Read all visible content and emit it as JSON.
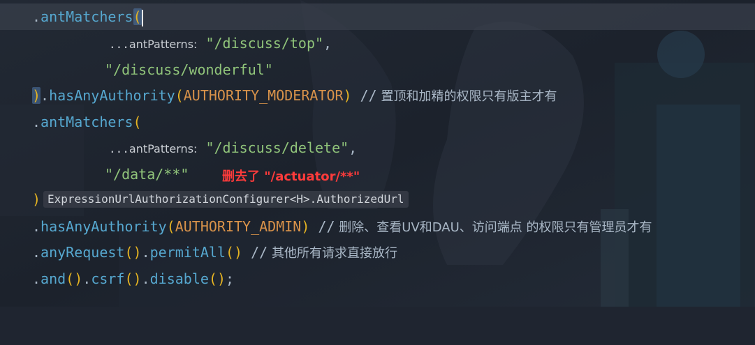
{
  "code": {
    "line1": {
      "dot": ".",
      "method": "antMatchers",
      "paren": "("
    },
    "line2": {
      "ellipsis": "...",
      "hint": "antPatterns:",
      "string": "\"/discuss/top\"",
      "comma": ","
    },
    "line3": {
      "string": "\"/discuss/wonderful\""
    },
    "line4": {
      "paren_close": ")",
      "dot": ".",
      "method": "hasAnyAuthority",
      "paren_open": "(",
      "constant": "AUTHORITY_MODERATOR",
      "paren_close2": ")",
      "comment_slashes": "//",
      "comment_text": "置顶和加精的权限只有版主才有"
    },
    "line5": {
      "dot": ".",
      "method": "antMatchers",
      "paren": "("
    },
    "line6": {
      "ellipsis": "...",
      "hint": "antPatterns:",
      "string": "\"/discuss/delete\"",
      "comma": ","
    },
    "line7": {
      "string": "\"/data/**\""
    },
    "line8": {
      "paren_close": ")",
      "type_hint": "ExpressionUrlAuthorizationConfigurer<H>.AuthorizedUrl"
    },
    "line9": {
      "dot": ".",
      "method": "hasAnyAuthority",
      "paren_open": "(",
      "constant": "AUTHORITY_ADMIN",
      "paren_close": ")",
      "comment_slashes": "//",
      "comment_text": "删除、查看UV和DAU、访问端点 的权限只有管理员才有"
    },
    "line10": {
      "dot": ".",
      "method": "anyRequest",
      "parens1": "()",
      "dot2": ".",
      "method2": "permitAll",
      "parens2": "()",
      "comment_slashes": "//",
      "comment_text": "其他所有请求直接放行"
    },
    "line11": {
      "dot": ".",
      "method": "and",
      "parens1": "()",
      "dot2": ".",
      "method2": "csrf",
      "parens2": "()",
      "dot3": ".",
      "method3": "disable",
      "parens3": "()",
      "semi": ";"
    }
  },
  "annotation": {
    "text": "删去了 \"/actuator/**\"",
    "color": "#ff3b3b"
  },
  "colors": {
    "background": "#1f2530",
    "method": "#56a8d0",
    "paren": "#e6b422",
    "string": "#90c47a",
    "constant": "#d8924a",
    "text": "#a9b7c6"
  }
}
